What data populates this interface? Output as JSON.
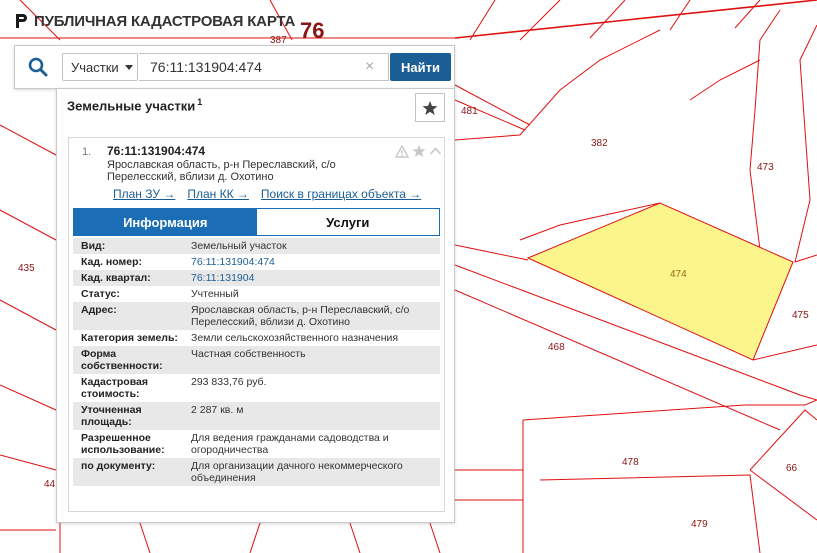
{
  "app": {
    "title": "ПУБЛИЧНАЯ КАДАСТРОВАЯ КАРТА"
  },
  "search": {
    "type_label": "Участки",
    "query": "76:11:131904:474",
    "clear_glyph": "×",
    "button_label": "Найти"
  },
  "panel": {
    "heading": "Земельные участки",
    "count": "1"
  },
  "result": {
    "index": "1.",
    "number": "76:11:131904:474",
    "address": "Ярославская область, р-н Переславский, с/о Перелесский, вблизи д. Охотино",
    "links": [
      "План ЗУ →",
      "План КК →",
      "Поиск в границах объекта →"
    ]
  },
  "tabs": [
    "Информация",
    "Услуги"
  ],
  "info": [
    {
      "key": "Вид:",
      "value": "Земельный участок"
    },
    {
      "key": "Кад. номер:",
      "value": "76:11:131904:474"
    },
    {
      "key": "Кад. квартал:",
      "value": "76:11:131904"
    },
    {
      "key": "Статус:",
      "value": "Учтенный"
    },
    {
      "key": "Адрес:",
      "value": "Ярославская область, р-н Переславский, с/о Перелесский, вблизи д. Охотино"
    },
    {
      "key": "Категория земель:",
      "value": "Земли сельскохозяйственного назначения"
    },
    {
      "key": "Форма собственности:",
      "value": "Частная собственность"
    },
    {
      "key": "Кадастровая стоимость:",
      "value": "293 833,76 руб."
    },
    {
      "key": "Уточненная площадь:",
      "value": "2 287 кв. м"
    },
    {
      "key": "Разрешенное использование:",
      "value": "Для ведения гражданами садоводства и огородничества"
    },
    {
      "key": "по документу:",
      "value": "Для организации дачного некоммерческого объединения"
    }
  ],
  "map": {
    "parcel_labels": [
      "76",
      "387",
      "481",
      "382",
      "473",
      "474",
      "475",
      "435",
      "468",
      "478",
      "66",
      "479",
      "44"
    ],
    "highlight_color": "#fbf58b",
    "line_color": "#e01010"
  },
  "icons": {
    "logo": "cadastral-logo-icon",
    "search": "search-icon",
    "favorite": "star-icon",
    "warning": "warning-icon",
    "collapse": "chevron-up-icon"
  }
}
